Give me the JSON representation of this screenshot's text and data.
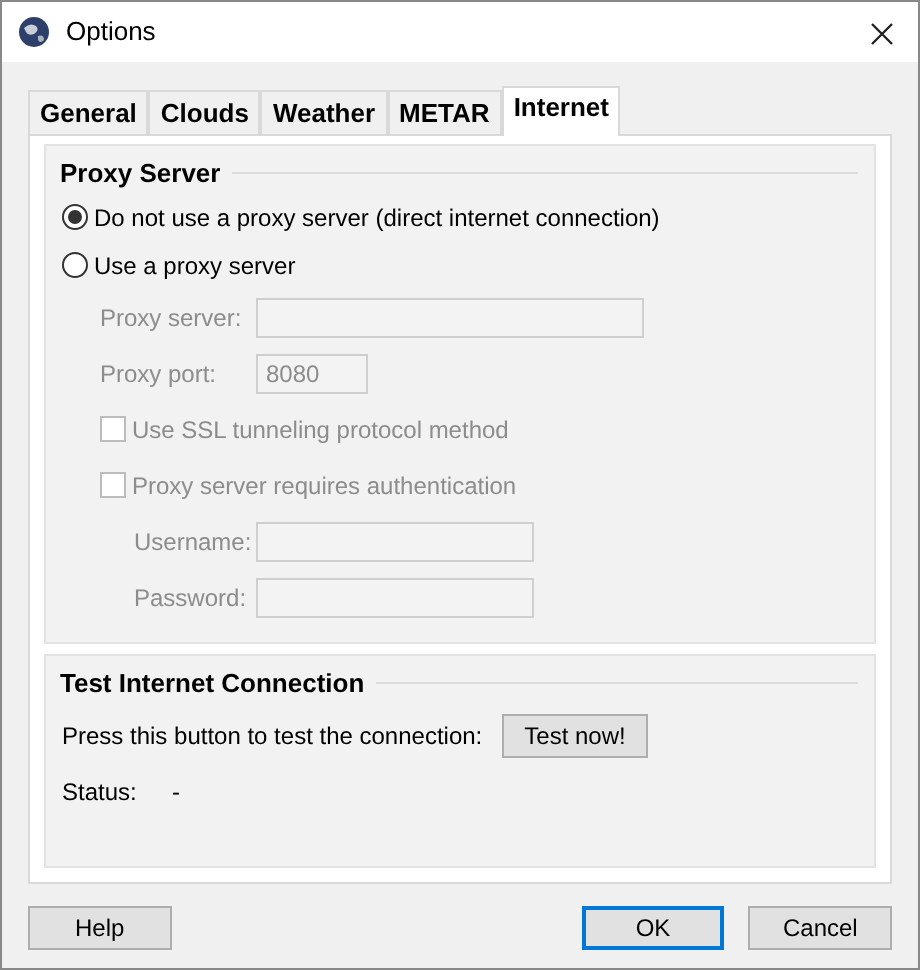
{
  "window": {
    "title": "Options"
  },
  "tabs": [
    {
      "label": "General",
      "selected": false
    },
    {
      "label": "Clouds",
      "selected": false
    },
    {
      "label": "Weather",
      "selected": false
    },
    {
      "label": "METAR",
      "selected": false
    },
    {
      "label": "Internet",
      "selected": true
    }
  ],
  "proxy_server": {
    "title": "Proxy Server",
    "options": [
      {
        "label": "Do not use a proxy server (direct internet connection)",
        "selected": true
      },
      {
        "label": "Use a proxy server",
        "selected": false
      }
    ],
    "fields": [
      {
        "label": "Proxy server:",
        "disabled": true
      },
      {
        "label": "Proxy port:",
        "value": "8080",
        "disabled": true
      }
    ],
    "checkboxes": [
      {
        "label": "Use SSL tunneling protocol method",
        "checked": false,
        "disabled": true
      },
      {
        "label": "Proxy server requires authentication",
        "checked": false,
        "disabled": true
      }
    ],
    "auth_fields": [
      {
        "label": "Username:",
        "disabled": true
      },
      {
        "label": "Password:",
        "disabled": true
      }
    ]
  },
  "test_connection": {
    "title": "Test Internet Connection",
    "prompt": "Press this button to test the connection:",
    "button": "Test now!",
    "status_label": "Status:",
    "status_value": "-"
  },
  "buttons": [
    {
      "label": "Help",
      "default": false
    },
    {
      "label": "OK",
      "default": true
    },
    {
      "label": "Cancel",
      "default": false
    }
  ]
}
